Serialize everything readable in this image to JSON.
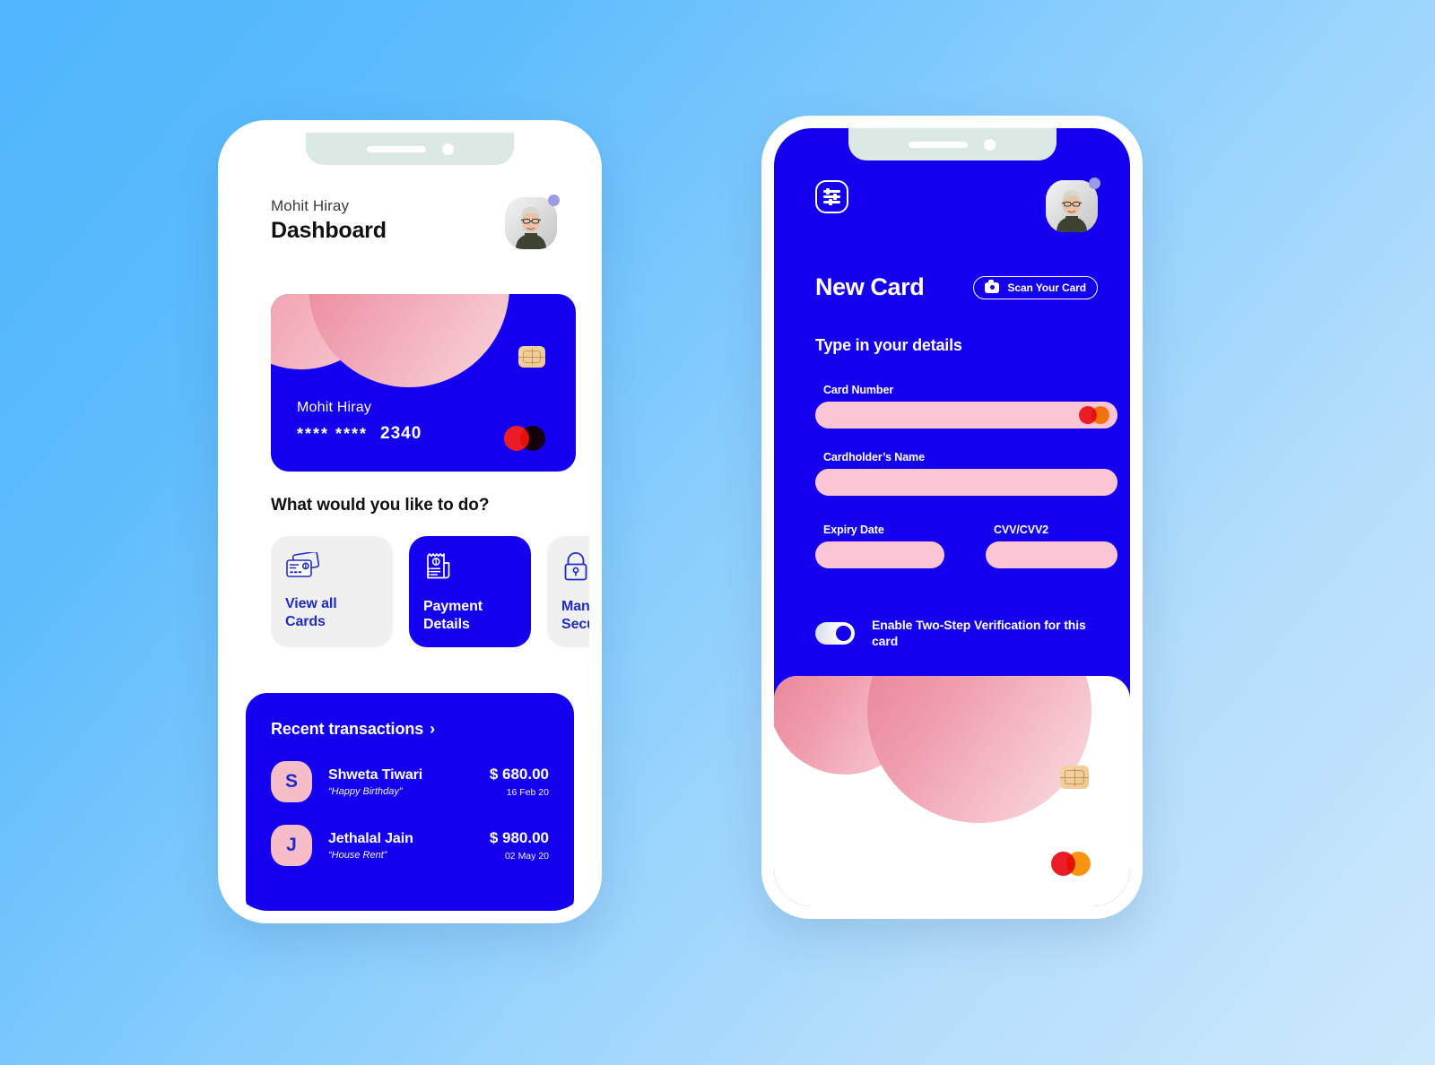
{
  "theme": {
    "brand_blue": "#1400EE",
    "pink": "#FBC5D3",
    "bg_from": "#4FB6FC",
    "bg_to": "#CDE8FC",
    "notch": "#DCE8E4",
    "mastercard_red": "#EB1C26",
    "mastercard_orange": "#F79410"
  },
  "dashboard": {
    "greeting_name": "Mohit Hiray",
    "page_title": "Dashboard",
    "avatar_name": "user-avatar",
    "card": {
      "holder": "Mohit Hiray",
      "masked": "****  ****",
      "last4": "2340",
      "network": "mastercard"
    },
    "actions_title": "What would you like to do?",
    "actions": [
      {
        "label": "View all Cards",
        "icon": "cards-icon",
        "active": false
      },
      {
        "label": "Payment Details",
        "icon": "receipt-icon",
        "active": true
      },
      {
        "label": "Manage Security",
        "icon": "lock-icon",
        "active": false
      }
    ],
    "transactions_title": "Recent transactions",
    "transactions_chevron": "›",
    "transactions": [
      {
        "initial": "S",
        "name": "Shweta Tiwari",
        "note": "“Happy Birthday”",
        "amount": "$ 680.00",
        "date": "16 Feb 20"
      },
      {
        "initial": "J",
        "name": "Jethalal Jain",
        "note": "“House Rent”",
        "amount": "$ 980.00",
        "date": "02 May 20"
      }
    ]
  },
  "new_card": {
    "settings_icon": "sliders-icon",
    "title": "New Card",
    "scan_button": "Scan Your Card",
    "scan_icon": "camera-icon",
    "subtitle": "Type in your details",
    "fields": [
      {
        "label": "Card Number",
        "value": "",
        "placeholder": ""
      },
      {
        "label": "Cardholder’s Name",
        "value": "",
        "placeholder": ""
      },
      {
        "label": "Expiry Date",
        "value": "",
        "placeholder": ""
      },
      {
        "label": "CVV/CVV2",
        "value": "",
        "placeholder": ""
      }
    ],
    "two_step": {
      "label": "Enable Two-Step Verification for this card",
      "enabled": true
    },
    "preview_card": {
      "network": "mastercard"
    }
  }
}
